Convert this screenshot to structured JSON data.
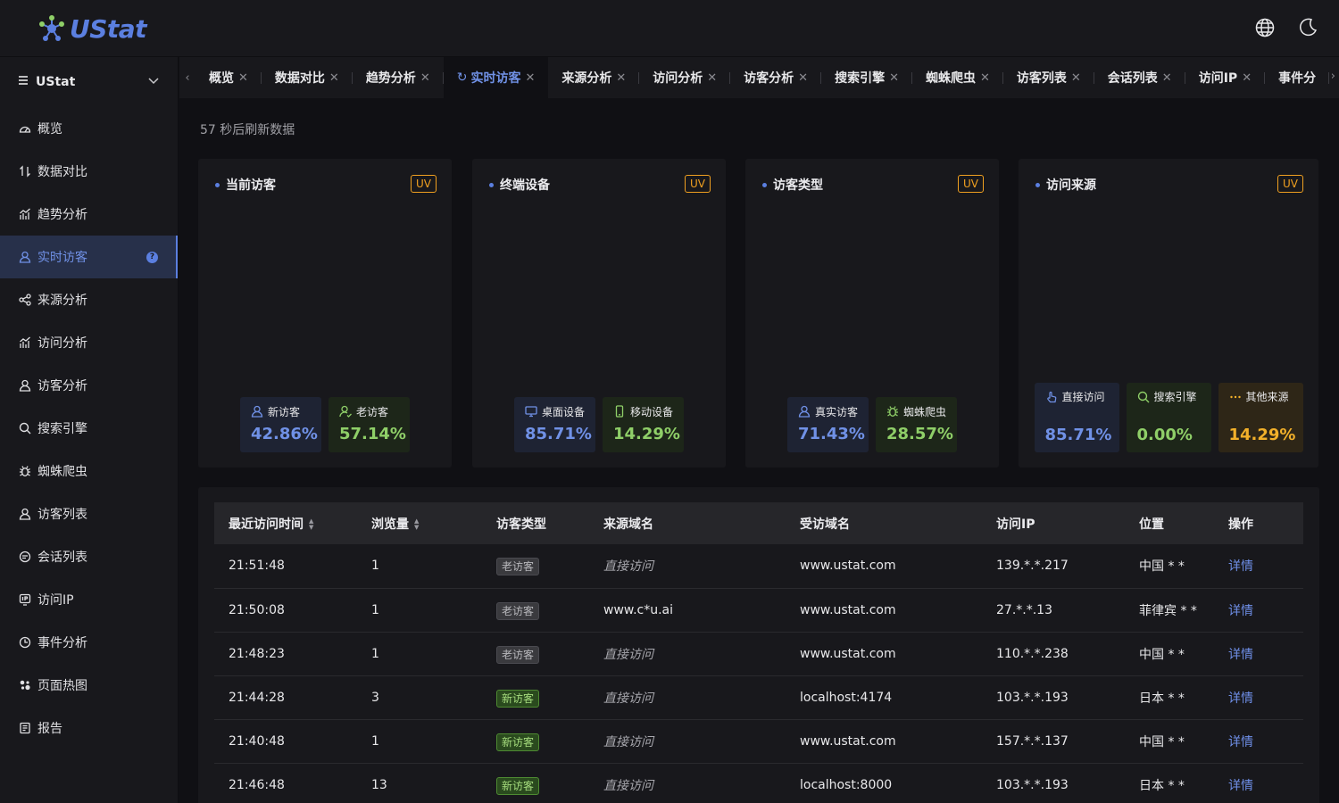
{
  "app": {
    "logo_text": "UStat",
    "brand_color": "#5b7fe0"
  },
  "header": {
    "icons": [
      "globe-icon",
      "moon-icon"
    ]
  },
  "sidebar": {
    "site": "UStat",
    "items": [
      {
        "label": "概览",
        "icon": "dashboard-icon",
        "active": false
      },
      {
        "label": "数据对比",
        "icon": "compare-icon",
        "active": false
      },
      {
        "label": "趋势分析",
        "icon": "trend-icon",
        "active": false
      },
      {
        "label": "实时访客",
        "icon": "user-icon",
        "active": true
      },
      {
        "label": "来源分析",
        "icon": "share-icon",
        "active": false
      },
      {
        "label": "访问分析",
        "icon": "chart-icon",
        "active": false
      },
      {
        "label": "访客分析",
        "icon": "user-icon",
        "active": false
      },
      {
        "label": "搜索引擎",
        "icon": "search-icon",
        "active": false
      },
      {
        "label": "蜘蛛爬虫",
        "icon": "bug-icon",
        "active": false
      },
      {
        "label": "访客列表",
        "icon": "user-icon",
        "active": false
      },
      {
        "label": "会话列表",
        "icon": "chat-icon",
        "active": false
      },
      {
        "label": "访问IP",
        "icon": "ip-icon",
        "active": false
      },
      {
        "label": "事件分析",
        "icon": "clock-icon",
        "active": false
      },
      {
        "label": "页面热图",
        "icon": "heatmap-icon",
        "active": false
      },
      {
        "label": "报告",
        "icon": "report-icon",
        "active": false
      }
    ]
  },
  "tabs": [
    {
      "label": "概览",
      "active": false
    },
    {
      "label": "数据对比",
      "active": false
    },
    {
      "label": "趋势分析",
      "active": false
    },
    {
      "label": "实时访客",
      "active": true
    },
    {
      "label": "来源分析",
      "active": false
    },
    {
      "label": "访问分析",
      "active": false
    },
    {
      "label": "访客分析",
      "active": false
    },
    {
      "label": "搜索引擎",
      "active": false
    },
    {
      "label": "蜘蛛爬虫",
      "active": false
    },
    {
      "label": "访客列表",
      "active": false
    },
    {
      "label": "会话列表",
      "active": false
    },
    {
      "label": "访问IP",
      "active": false
    },
    {
      "label": "事件分",
      "active": false
    }
  ],
  "refresh_note": "57 秒后刷新数据",
  "cards": [
    {
      "title": "当前访客",
      "badge": "UV",
      "stats": [
        {
          "label": "新访客",
          "value": "42.86%",
          "color": "blue",
          "icon": "user-icon"
        },
        {
          "label": "老访客",
          "value": "57.14%",
          "color": "green",
          "icon": "user-check-icon"
        }
      ]
    },
    {
      "title": "终端设备",
      "badge": "UV",
      "stats": [
        {
          "label": "桌面设备",
          "value": "85.71%",
          "color": "blue",
          "icon": "monitor-icon"
        },
        {
          "label": "移动设备",
          "value": "14.29%",
          "color": "green",
          "icon": "mobile-icon"
        }
      ]
    },
    {
      "title": "访客类型",
      "badge": "UV",
      "stats": [
        {
          "label": "真实访客",
          "value": "71.43%",
          "color": "blue",
          "icon": "user-icon"
        },
        {
          "label": "蜘蛛爬虫",
          "value": "28.57%",
          "color": "green",
          "icon": "bug-icon"
        }
      ]
    },
    {
      "title": "访问来源",
      "badge": "UV",
      "stats": [
        {
          "label": "直接访问",
          "value": "85.71%",
          "color": "blue",
          "icon": "pointer-icon"
        },
        {
          "label": "搜索引擎",
          "value": "0.00%",
          "color": "green",
          "icon": "search-icon"
        },
        {
          "label": "其他来源",
          "value": "14.29%",
          "color": "orange",
          "icon": "more-icon"
        }
      ]
    }
  ],
  "table": {
    "headers": [
      "最近访问时间",
      "浏览量",
      "访客类型",
      "来源域名",
      "受访域名",
      "访问IP",
      "位置",
      "操作"
    ],
    "rows": [
      {
        "time": "21:51:48",
        "views": "1",
        "type": "老访客",
        "is_new": false,
        "source": "直接访问",
        "direct": true,
        "domain": "www.ustat.com",
        "ip": "139.*.*.217",
        "location": "中国 * *",
        "action": "详情"
      },
      {
        "time": "21:50:08",
        "views": "1",
        "type": "老访客",
        "is_new": false,
        "source": "www.c*u.ai",
        "direct": false,
        "domain": "www.ustat.com",
        "ip": "27.*.*.13",
        "location": "菲律宾 * *",
        "action": "详情"
      },
      {
        "time": "21:48:23",
        "views": "1",
        "type": "老访客",
        "is_new": false,
        "source": "直接访问",
        "direct": true,
        "domain": "www.ustat.com",
        "ip": "110.*.*.238",
        "location": "中国 * *",
        "action": "详情"
      },
      {
        "time": "21:44:28",
        "views": "3",
        "type": "新访客",
        "is_new": true,
        "source": "直接访问",
        "direct": true,
        "domain": "localhost:4174",
        "ip": "103.*.*.193",
        "location": "日本 * *",
        "action": "详情"
      },
      {
        "time": "21:40:48",
        "views": "1",
        "type": "新访客",
        "is_new": true,
        "source": "直接访问",
        "direct": true,
        "domain": "www.ustat.com",
        "ip": "157.*.*.137",
        "location": "中国 * *",
        "action": "详情"
      },
      {
        "time": "21:46:48",
        "views": "13",
        "type": "新访客",
        "is_new": true,
        "source": "直接访问",
        "direct": true,
        "domain": "localhost:8000",
        "ip": "103.*.*.193",
        "location": "日本 * *",
        "action": "详情"
      }
    ]
  }
}
